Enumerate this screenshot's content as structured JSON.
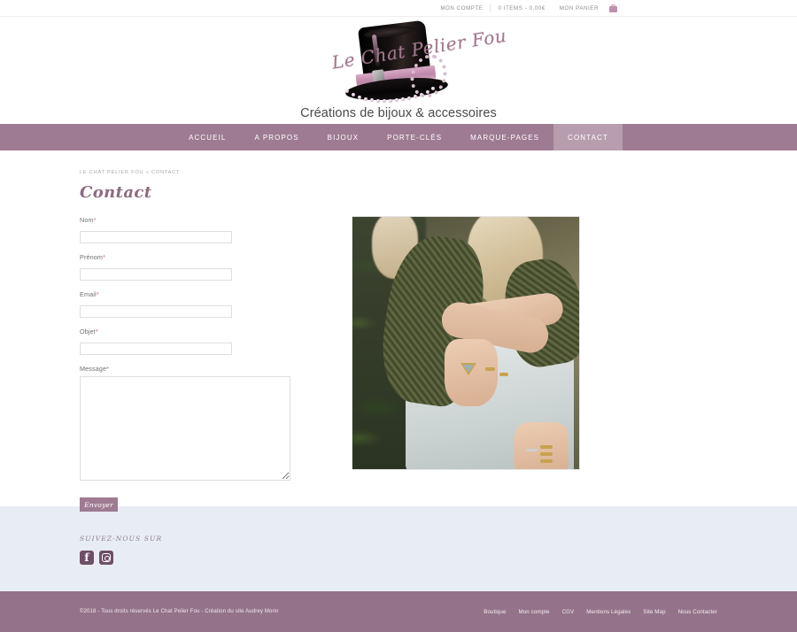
{
  "topbar": {
    "account_label": "MON COMPTE",
    "cart_summary": "0 ITEMS - 0,00€",
    "cart_label": "MON PANIER",
    "cart_icon": "shopping-bag-icon"
  },
  "logo": {
    "script_name": "Le Chat Pelier Fou",
    "tagline": "Créations de bijoux & accessoires"
  },
  "nav": {
    "items": [
      {
        "label": "ACCUEIL",
        "active": false
      },
      {
        "label": "A PROPOS",
        "active": false
      },
      {
        "label": "BIJOUX",
        "active": false
      },
      {
        "label": "PORTE-CLÉS",
        "active": false
      },
      {
        "label": "MARQUE-PAGES",
        "active": false
      },
      {
        "label": "CONTACT",
        "active": true
      }
    ]
  },
  "breadcrumb": {
    "home": "LE CHAT PELIER FOU",
    "separator": "»",
    "current": "CONTACT"
  },
  "page": {
    "title": "Contact"
  },
  "form": {
    "fields": [
      {
        "label": "Nom",
        "required": "*",
        "value": "",
        "placeholder": ""
      },
      {
        "label": "Prénom",
        "required": "*",
        "value": "",
        "placeholder": ""
      },
      {
        "label": "Email",
        "required": "*",
        "value": "",
        "placeholder": ""
      },
      {
        "label": "Objet",
        "required": "*",
        "value": "",
        "placeholder": ""
      }
    ],
    "message": {
      "label": "Message",
      "required": "*",
      "value": "",
      "placeholder": ""
    },
    "submit_label": "Envoyer"
  },
  "photo": {
    "alt": "Femme portant des bagues dorées, pull en maille kaki et robe blanche dans la verdure"
  },
  "social": {
    "title": "SUIVEZ-NOUS SUR",
    "items": [
      {
        "name": "facebook",
        "glyph": "f"
      },
      {
        "name": "instagram",
        "glyph": ""
      }
    ]
  },
  "footer": {
    "copyright": "©2018 - Tous droits réservés Le Chat Pelier Fou - Création du site Audrey Morin",
    "links": [
      "Boutique",
      "Mon compte",
      "CGV",
      "Mentions Légales",
      "Site Map",
      "Nous Contacter"
    ]
  },
  "colors": {
    "brand_purple": "#9e7b92",
    "brand_purple_active": "#b79dad",
    "footer_purple": "#94738a",
    "social_band": "#e8edf3",
    "social_icon": "#6e4f66",
    "required_star": "#c96a7f",
    "title_purple": "#8d6a80"
  }
}
